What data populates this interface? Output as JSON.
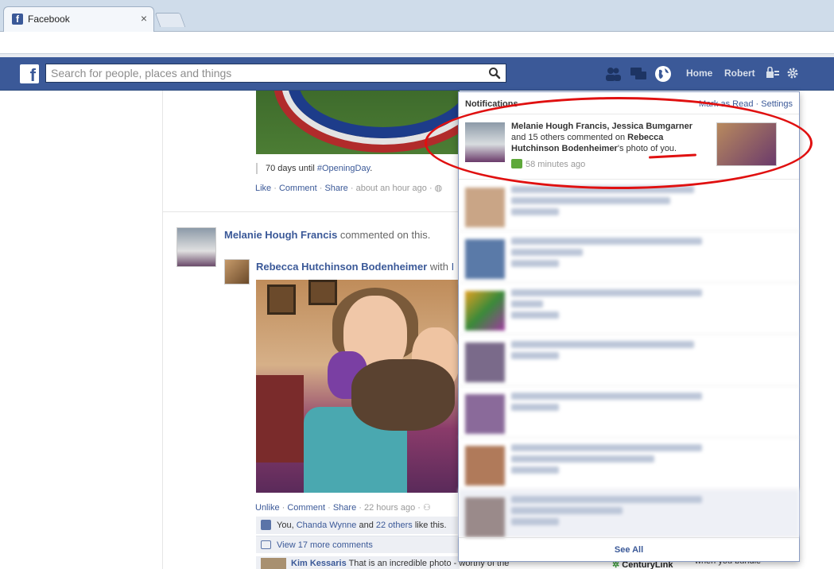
{
  "browser": {
    "tab_title": "Facebook",
    "tab_close": "×",
    "favicon_letter": "f"
  },
  "topbar": {
    "logo_letter": "f",
    "search_placeholder": "Search for people, places and things",
    "home_label": "Home",
    "user_label": "Robert",
    "brand_color": "#3b5998"
  },
  "feed": {
    "quote_prefix": "70 days until ",
    "quote_tag": "#OpeningDay",
    "quote_suffix": ".",
    "post1_actions": {
      "like": "Like",
      "comment": "Comment",
      "share": "Share",
      "time": "about an hour ago"
    },
    "story_actor": "Melanie Hough Francis",
    "story_verb": " commented on this.",
    "post_author": "Rebecca Hutchinson Bodenheimer",
    "post_with": " with ",
    "post_with_trunc": "I",
    "post2_actions": {
      "unlike": "Unlike",
      "comment": "Comment",
      "share": "Share",
      "time": "22 hours ago"
    },
    "likes": {
      "you": "You, ",
      "friend": "Chanda Wynne",
      "and": " and ",
      "others": "22 others",
      "suffix": " like this."
    },
    "more_comments": "View 17 more comments",
    "comment_author": "Kim Kessaris",
    "comment_text": " That is an incredible photo - worthy of the",
    "right_ad_brand": "CenturyLink",
    "right_ad_text": "when you bundle"
  },
  "notifications": {
    "title": "Notifications",
    "mark_read": "Mark as Read",
    "sep": " · ",
    "settings": "Settings",
    "first": {
      "actors": "Melanie Hough Francis, Jessica Bumgarner",
      "middle": " and 15 others commented on ",
      "target": "Rebecca Hutchinson Bodenheimer",
      "suffix": "'s photo of you.",
      "time": "58 minutes ago"
    },
    "see_all": "See All"
  }
}
